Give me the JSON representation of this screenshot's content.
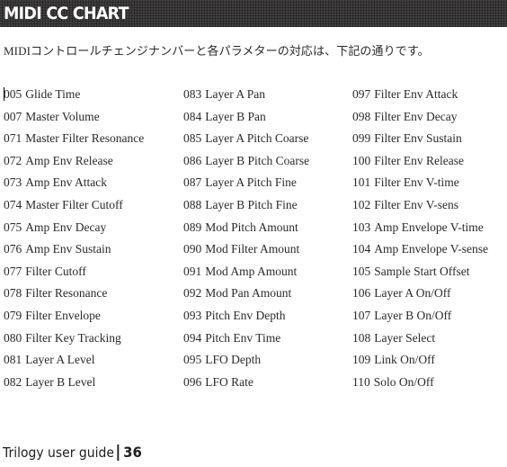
{
  "header": {
    "title": "MIDI CC CHART"
  },
  "intro": {
    "text": "MIDIコントロールチェンジナンバーと各パラメターの対応は、下記の通りです。"
  },
  "columns": [
    {
      "items": [
        {
          "number": "005",
          "name": "Glide Time"
        },
        {
          "number": "007",
          "name": "Master Volume"
        },
        {
          "number": "071",
          "name": "Master Filter Resonance"
        },
        {
          "number": "072",
          "name": "Amp Env Release"
        },
        {
          "number": "073",
          "name": "Amp Env Attack"
        },
        {
          "number": "074",
          "name": "Master Filter Cutoff"
        },
        {
          "number": "075",
          "name": "Amp Env Decay"
        },
        {
          "number": "076",
          "name": "Amp Env Sustain"
        },
        {
          "number": "077",
          "name": "Filter Cutoff"
        },
        {
          "number": "078",
          "name": "Filter Resonance"
        },
        {
          "number": "079",
          "name": "Filter Envelope"
        },
        {
          "number": "080",
          "name": "Filter Key Tracking"
        },
        {
          "number": "081",
          "name": "Layer A Level"
        },
        {
          "number": "082",
          "name": "Layer B Level"
        }
      ]
    },
    {
      "items": [
        {
          "number": "083",
          "name": "Layer A Pan"
        },
        {
          "number": "084",
          "name": "Layer B Pan"
        },
        {
          "number": "085",
          "name": "Layer A Pitch Coarse"
        },
        {
          "number": "086",
          "name": "Layer B Pitch Coarse"
        },
        {
          "number": "087",
          "name": "Layer A Pitch Fine"
        },
        {
          "number": "088",
          "name": "Layer B Pitch Fine"
        },
        {
          "number": "089",
          "name": "Mod Pitch Amount"
        },
        {
          "number": "090",
          "name": "Mod Filter Amount"
        },
        {
          "number": "091",
          "name": "Mod Amp Amount"
        },
        {
          "number": "092",
          "name": "Mod Pan Amount"
        },
        {
          "number": "093",
          "name": "Pitch Env Depth"
        },
        {
          "number": "094",
          "name": "Pitch Env Time"
        },
        {
          "number": "095",
          "name": "LFO Depth"
        },
        {
          "number": "096",
          "name": "LFO Rate"
        }
      ]
    },
    {
      "items": [
        {
          "number": "097",
          "name": "Filter Env Attack"
        },
        {
          "number": "098",
          "name": "Filter Env Decay"
        },
        {
          "number": "099",
          "name": "Filter Env Sustain"
        },
        {
          "number": "100",
          "name": "Filter Env Release"
        },
        {
          "number": "101",
          "name": "Filter Env V-time"
        },
        {
          "number": "102",
          "name": "Filter Env V-sens"
        },
        {
          "number": "103",
          "name": "Amp Envelope V-time"
        },
        {
          "number": "104",
          "name": "Amp Envelope V-sense"
        },
        {
          "number": "105",
          "name": "Sample Start Offset"
        },
        {
          "number": "106",
          "name": "Layer A On/Off"
        },
        {
          "number": "107",
          "name": "Layer B On/Off"
        },
        {
          "number": "108",
          "name": "Layer Select"
        },
        {
          "number": "109",
          "name": "Link On/Off"
        },
        {
          "number": "110",
          "name": "Solo On/Off"
        }
      ]
    }
  ],
  "footer": {
    "guide_title": "Trilogy user guide",
    "page_number": "36"
  }
}
